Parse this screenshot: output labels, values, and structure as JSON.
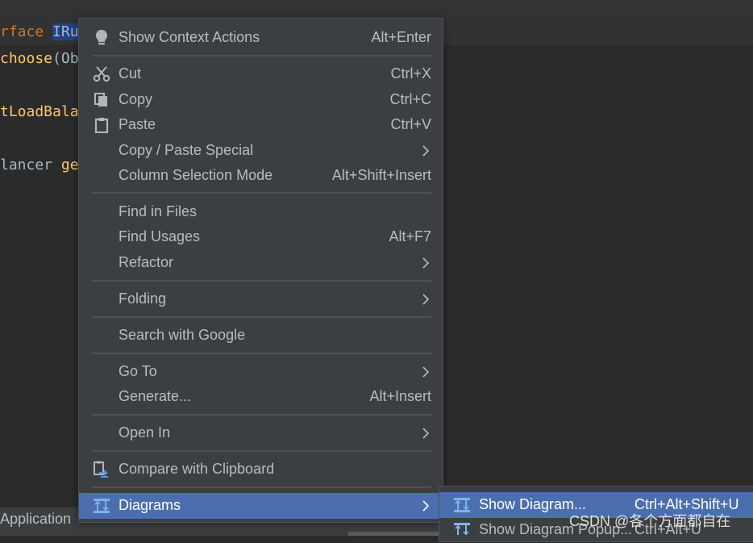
{
  "editor": {
    "line1": {
      "keyword": "rface",
      "selected": "IRu"
    },
    "line2": {
      "method": "choose",
      "rest": "(Ob"
    },
    "line3": {
      "method": "tLoadBala"
    },
    "line4": {
      "type": "lancer",
      "method": "ge"
    }
  },
  "statusbar": {
    "label": "Application"
  },
  "context_menu": {
    "show_context_actions": {
      "label": "Show Context Actions",
      "shortcut": "Alt+Enter",
      "icon": "lightbulb-icon"
    },
    "cut": {
      "label": "Cut",
      "shortcut": "Ctrl+X",
      "icon": "scissors-icon"
    },
    "copy": {
      "label": "Copy",
      "shortcut": "Ctrl+C",
      "icon": "copy-icon"
    },
    "paste": {
      "label": "Paste",
      "shortcut": "Ctrl+V",
      "icon": "clipboard-icon"
    },
    "copy_paste_special": {
      "label": "Copy / Paste Special"
    },
    "column_selection_mode": {
      "label": "Column Selection Mode",
      "shortcut": "Alt+Shift+Insert"
    },
    "find_in_files": {
      "label": "Find in Files"
    },
    "find_usages": {
      "label": "Find Usages",
      "shortcut": "Alt+F7"
    },
    "refactor": {
      "label": "Refactor"
    },
    "folding": {
      "label": "Folding"
    },
    "search_with_google": {
      "label": "Search with Google"
    },
    "go_to": {
      "label": "Go To"
    },
    "generate": {
      "label": "Generate...",
      "shortcut": "Alt+Insert"
    },
    "open_in": {
      "label": "Open In"
    },
    "compare_with_clipboard": {
      "label": "Compare with Clipboard",
      "icon": "compare-icon"
    },
    "diagrams": {
      "label": "Diagrams",
      "icon": "diagram-icon",
      "selected": true
    }
  },
  "diagrams_submenu": {
    "show_diagram": {
      "label": "Show Diagram...",
      "shortcut": "Ctrl+Alt+Shift+U",
      "selected": true
    },
    "show_diagram_popup": {
      "label": "Show Diagram Popup...",
      "shortcut": "Ctrl+Alt+U"
    }
  },
  "watermark": "CSDN @各个方面都自在",
  "colors": {
    "editor_bg": "#2b2b2b",
    "menu_bg": "#3c3f41",
    "selection": "#4b6eaf",
    "text": "#bbbbbb",
    "keyword": "#cc7832",
    "method": "#ffc66d"
  }
}
